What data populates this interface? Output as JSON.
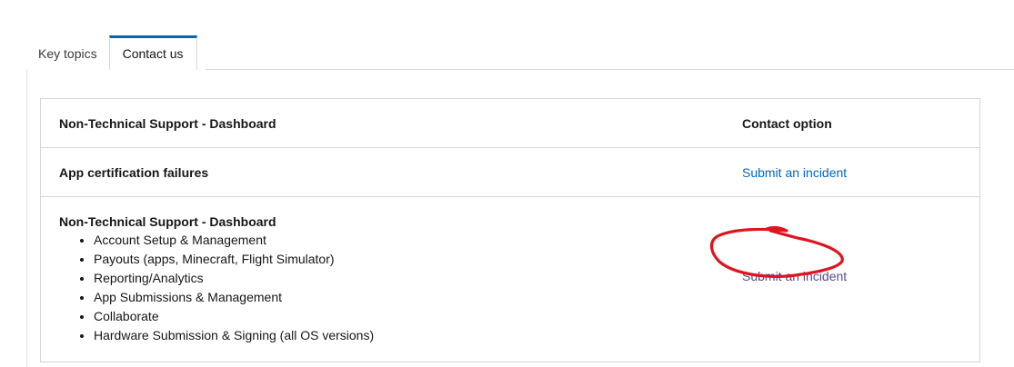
{
  "tabs": [
    {
      "label": "Key topics"
    },
    {
      "label": "Contact us"
    }
  ],
  "table": {
    "header": {
      "col1": "Non-Technical Support - Dashboard",
      "col2": "Contact option"
    },
    "rows": [
      {
        "label": "App certification failures",
        "action": "Submit an incident"
      },
      {
        "label": "Non-Technical Support - Dashboard",
        "items": [
          "Account Setup & Management",
          "Payouts (apps, Minecraft, Flight Simulator)",
          "Reporting/Analytics",
          "App Submissions & Management",
          "Collaborate",
          "Hardware Submission & Signing (all OS versions)"
        ],
        "action": "Submit an incident"
      }
    ]
  },
  "colors": {
    "accent": "#0067b8",
    "annotation": "#e0141e"
  },
  "annotation": {
    "icon": "red-circle-annotation"
  }
}
